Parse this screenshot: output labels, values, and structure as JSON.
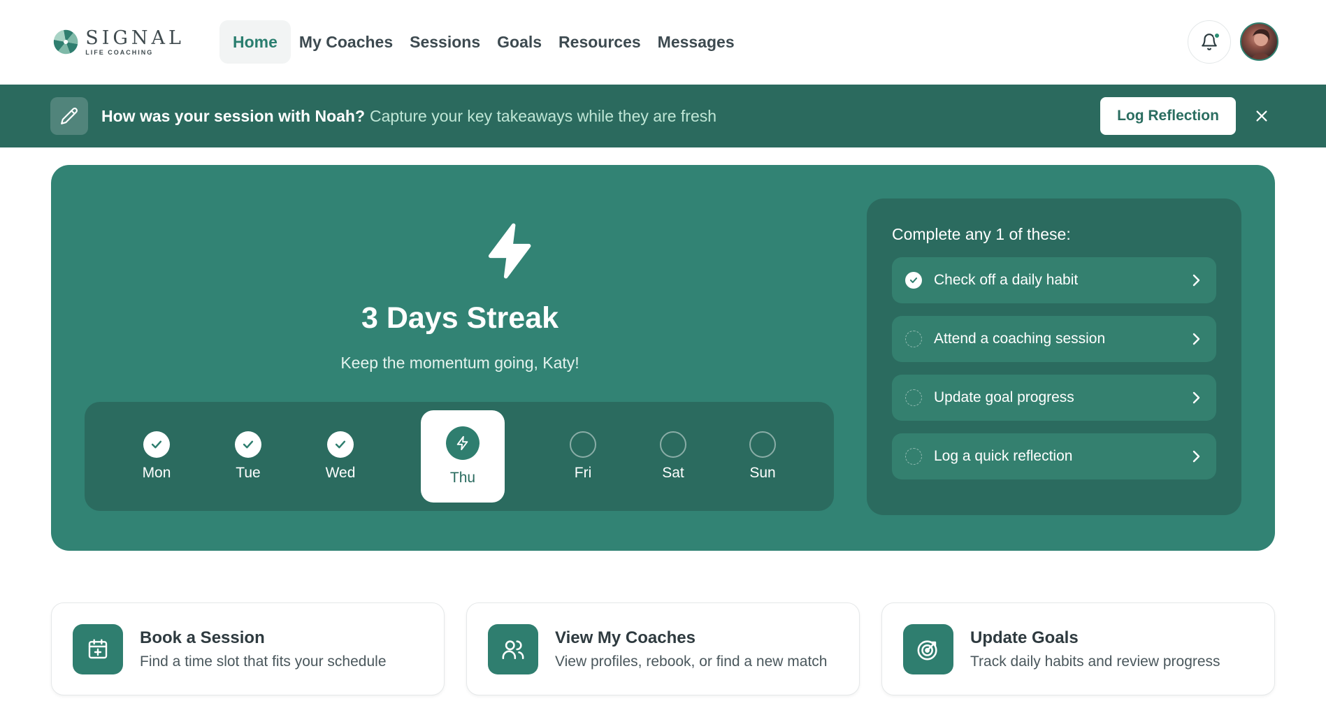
{
  "header": {
    "logo_word": "SIGNAL",
    "logo_sub": "LIFE COACHING",
    "nav": [
      "Home",
      "My Coaches",
      "Sessions",
      "Goals",
      "Resources",
      "Messages"
    ],
    "active_nav": "Home",
    "icons": {
      "notifications": "bell-icon",
      "avatar": "user-avatar"
    }
  },
  "banner": {
    "bold_text": "How was your session with Noah?",
    "light_text": "Capture your key takeaways while they are fresh",
    "button_label": "Log Reflection",
    "icons": {
      "lead": "pencil-icon",
      "close": "close-icon"
    }
  },
  "streak": {
    "title": "3 Days Streak",
    "subtitle": "Keep the momentum going, Katy!",
    "days": [
      {
        "label": "Mon",
        "state": "done"
      },
      {
        "label": "Tue",
        "state": "done"
      },
      {
        "label": "Wed",
        "state": "done"
      },
      {
        "label": "Thu",
        "state": "today"
      },
      {
        "label": "Fri",
        "state": "open"
      },
      {
        "label": "Sat",
        "state": "open"
      },
      {
        "label": "Sun",
        "state": "open"
      }
    ],
    "tasks_title": "Complete any 1 of these:",
    "tasks": [
      {
        "label": "Check off a daily habit",
        "done": true
      },
      {
        "label": "Attend a coaching session",
        "done": false
      },
      {
        "label": "Update goal progress",
        "done": false
      },
      {
        "label": "Log a quick reflection",
        "done": false
      }
    ]
  },
  "quick_actions": [
    {
      "title": "Book a Session",
      "desc": "Find a time slot that fits your schedule",
      "icon": "calendar-plus-icon"
    },
    {
      "title": "View My Coaches",
      "desc": "View profiles, rebook, or find a new match",
      "icon": "users-icon"
    },
    {
      "title": "Update Goals",
      "desc": "Track daily habits and review progress",
      "icon": "target-icon"
    }
  ],
  "colors": {
    "primary": "#328374",
    "primary_dark": "#2b6b5f",
    "banner": "#2b6a5e",
    "accent_text": "#2a7e6f"
  }
}
